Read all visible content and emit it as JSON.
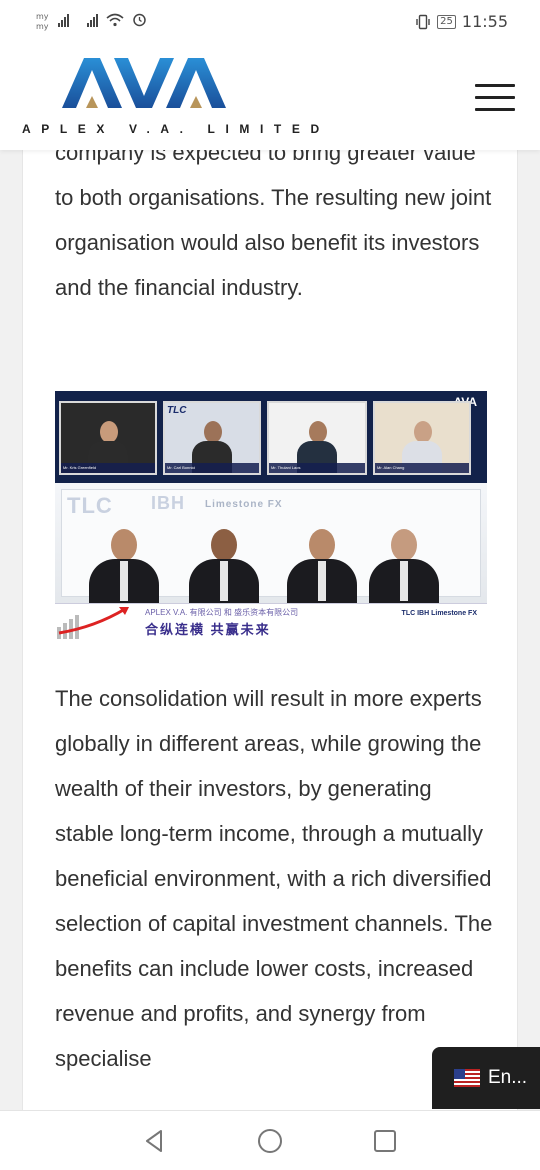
{
  "status_bar": {
    "carrier_line1": "my",
    "carrier_line2": "my",
    "battery": "25",
    "time": "11:55"
  },
  "header": {
    "logo_text": "AVA",
    "tagline": "APLEX V.A. LIMITED",
    "menu_icon": "hamburger-menu-icon"
  },
  "article": {
    "paragraph_1": "company is expected to bring greater value to both organisations. The resulting new joint organisation would also benefit its investors and the financial industry.",
    "paragraph_2": "The consolidation will result in more experts globally in different areas, while growing the wealth of their investors, by generating stable long-term income, through a mutually beneficial environment, with a rich diversified selection of capital investment channels. The benefits can include lower costs, increased revenue and profits, and synergy from specialise"
  },
  "photo": {
    "top_logo": "AVA",
    "tile_logos": [
      "TLC",
      "IBH",
      "AVA"
    ],
    "stage_logos": [
      "TLC",
      "IBH",
      "Limestone FX"
    ],
    "banner_line1": "APLEX V.A. 有限公司 和 盛乐资本有限公司",
    "banner_line2": "合纵连横 共赢未来",
    "banner_logos": "TLC  IBH  Limestone FX"
  },
  "language_switcher": {
    "label": "En...",
    "flag_icon": "us-flag-icon"
  },
  "nav_bar": {
    "back_icon": "back-triangle-icon",
    "home_icon": "home-circle-icon",
    "recents_icon": "recents-square-icon"
  },
  "colors": {
    "brand_blue": "#1f4e9c",
    "brand_gold": "#b8955a",
    "text": "#333333",
    "lang_bg": "#1f1f1f"
  }
}
